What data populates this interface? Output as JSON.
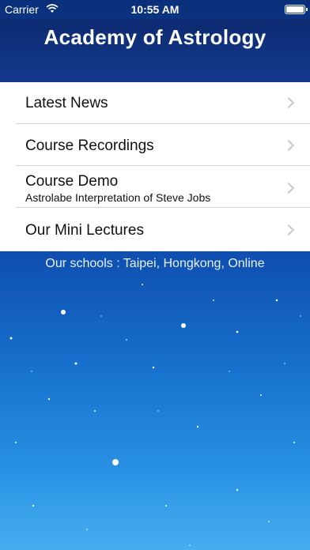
{
  "status_bar": {
    "carrier": "Carrier",
    "time": "10:55 AM",
    "wifi_icon": "wifi-icon",
    "battery_icon": "battery-icon"
  },
  "header": {
    "title": "Academy of Astrology"
  },
  "menu": {
    "items": [
      {
        "label": "Latest News",
        "sub": ""
      },
      {
        "label": "Course Recordings",
        "sub": ""
      },
      {
        "label": "Course Demo",
        "sub": "Astrolabe Interpretation of Steve Jobs"
      },
      {
        "label": "Our Mini Lectures",
        "sub": ""
      }
    ]
  },
  "footer": {
    "schools": "Our schools : Taipei, Hongkong, Online"
  }
}
